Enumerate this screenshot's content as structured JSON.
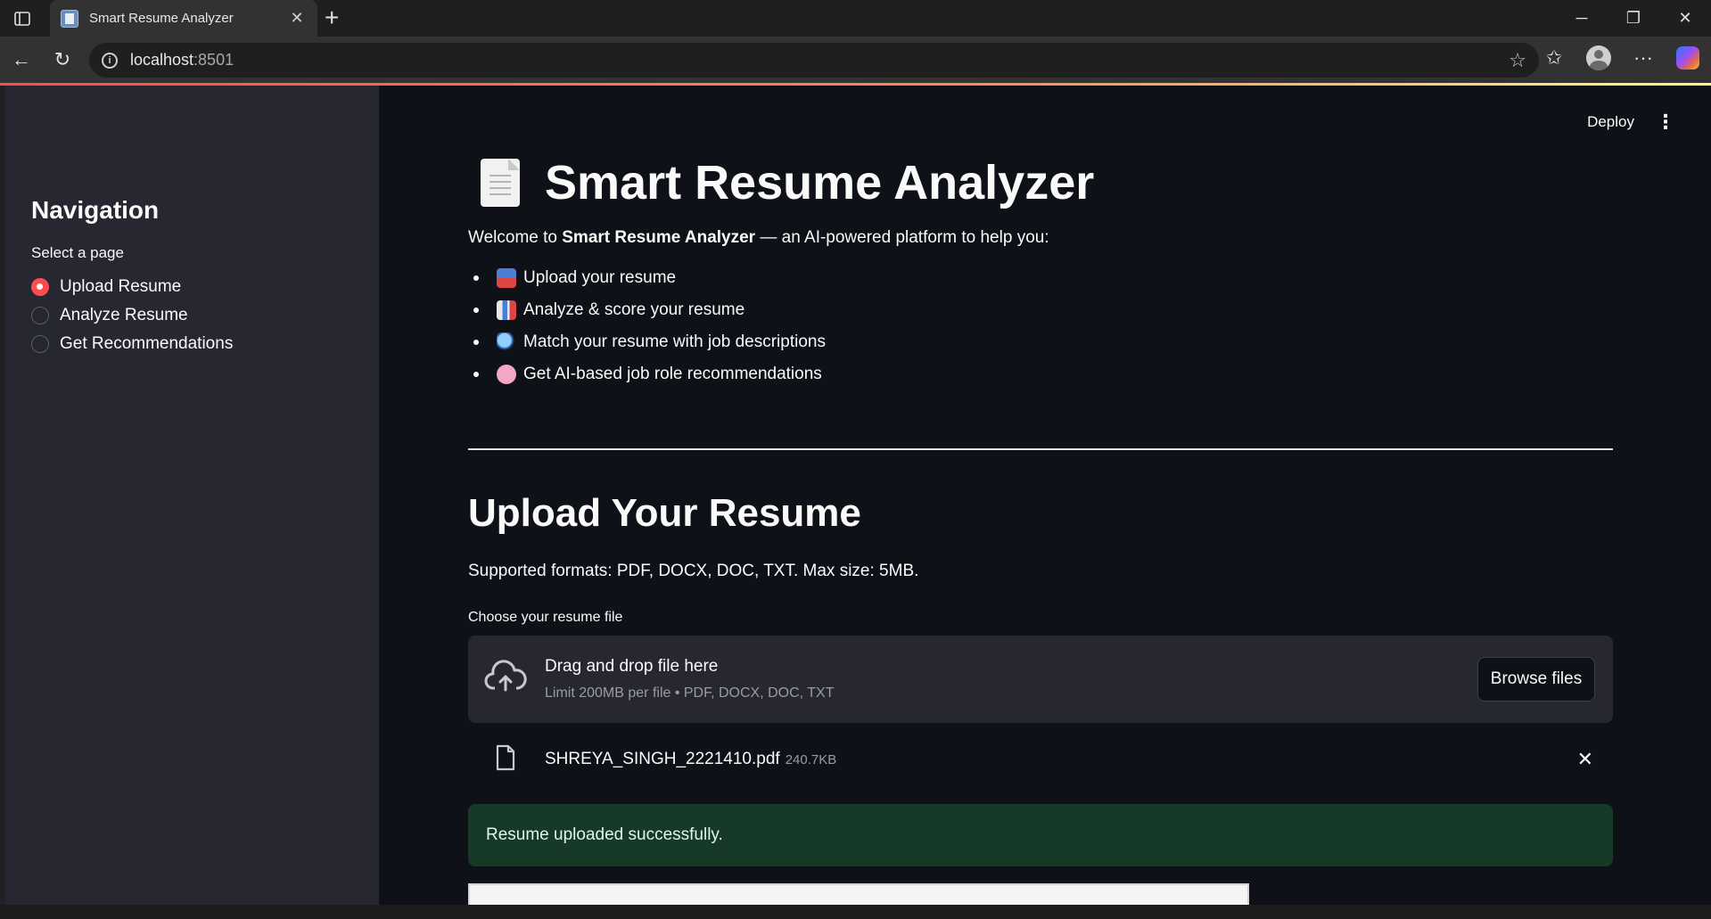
{
  "browser": {
    "tab_title": "Smart Resume Analyzer",
    "url_host": "localhost",
    "url_port": ":8501"
  },
  "sidebar": {
    "title": "Navigation",
    "label": "Select a page",
    "options": [
      {
        "label": "Upload Resume",
        "selected": true
      },
      {
        "label": "Analyze Resume",
        "selected": false
      },
      {
        "label": "Get Recommendations",
        "selected": false
      }
    ]
  },
  "header": {
    "deploy_label": "Deploy"
  },
  "main": {
    "title": "Smart Resume Analyzer",
    "welcome_prefix": "Welcome to ",
    "welcome_bold": "Smart Resume Analyzer",
    "welcome_suffix": " — an AI-powered platform to help you:",
    "bullets": [
      {
        "icon": "inbox-tray-icon",
        "text": "Upload your resume"
      },
      {
        "icon": "bar-chart-icon",
        "text": "Analyze & score your resume"
      },
      {
        "icon": "magnifier-icon",
        "text": "Match your resume with job descriptions"
      },
      {
        "icon": "brain-icon",
        "text": "Get AI-based job role recommendations"
      }
    ],
    "upload_heading": "Upload Your Resume",
    "formats_text": "Supported formats: PDF, DOCX, DOC, TXT. Max size: 5MB.",
    "uploader_label": "Choose your resume file",
    "dropzone_main": "Drag and drop file here",
    "dropzone_sub": "Limit 200MB per file • PDF, DOCX, DOC, TXT",
    "browse_label": "Browse files",
    "file_name": "SHREYA_SINGH_2221410.pdf",
    "file_size": "240.7KB",
    "success_message": "Resume uploaded successfully."
  },
  "colors": {
    "primary": "#ff4b4b",
    "background": "#0e1117",
    "sidebar_bg": "#262730",
    "success_bg": "#173928"
  }
}
